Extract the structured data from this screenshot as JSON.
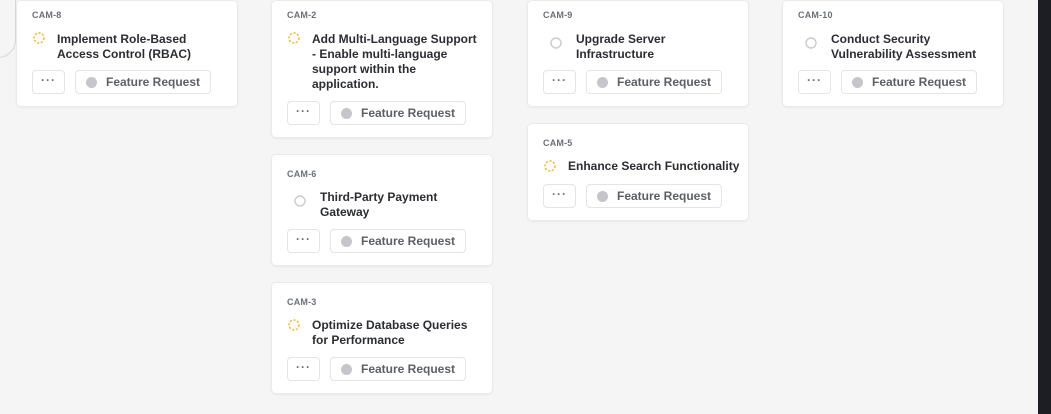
{
  "colors": {
    "in_progress": "#f2b531",
    "todo": "#c9cbd0",
    "label_dot": "#c4c6cb",
    "board_bg": "#f5f5f6"
  },
  "cards": {
    "cam8": {
      "id": "CAM-8",
      "status": "in-progress",
      "status_icon": "dashed-circle-icon",
      "title_lines": [
        "Implement Role-Based",
        "Access Control (RBAC)"
      ],
      "more_label": "···",
      "label": "Feature Request"
    },
    "cam2": {
      "id": "CAM-2",
      "status": "in-progress",
      "status_icon": "dashed-circle-icon",
      "title_lines": [
        "Add Multi-Language Support",
        "- Enable multi-language",
        "support within the",
        "application."
      ],
      "more_label": "···",
      "label": "Feature Request"
    },
    "cam6": {
      "id": "CAM-6",
      "status": "todo",
      "status_icon": "empty-circle-icon",
      "title_lines": [
        "Third-Party Payment",
        "Gateway"
      ],
      "more_label": "···",
      "label": "Feature Request"
    },
    "cam3": {
      "id": "CAM-3",
      "status": "in-progress",
      "status_icon": "dashed-circle-icon",
      "title_lines": [
        "Optimize Database Queries",
        "for Performance"
      ],
      "more_label": "···",
      "label": "Feature Request"
    },
    "cam9": {
      "id": "CAM-9",
      "status": "todo",
      "status_icon": "empty-circle-icon",
      "title_lines": [
        "Upgrade Server",
        "Infrastructure"
      ],
      "more_label": "···",
      "label": "Feature Request"
    },
    "cam5": {
      "id": "CAM-5",
      "status": "in-progress",
      "status_icon": "dashed-circle-icon",
      "title_lines": [
        "Enhance Search Functionality"
      ],
      "more_label": "···",
      "label": "Feature Request"
    },
    "cam10": {
      "id": "CAM-10",
      "status": "todo",
      "status_icon": "empty-circle-icon",
      "title_lines": [
        "Conduct Security",
        "Vulnerability Assessment"
      ],
      "more_label": "···",
      "label": "Feature Request"
    }
  }
}
